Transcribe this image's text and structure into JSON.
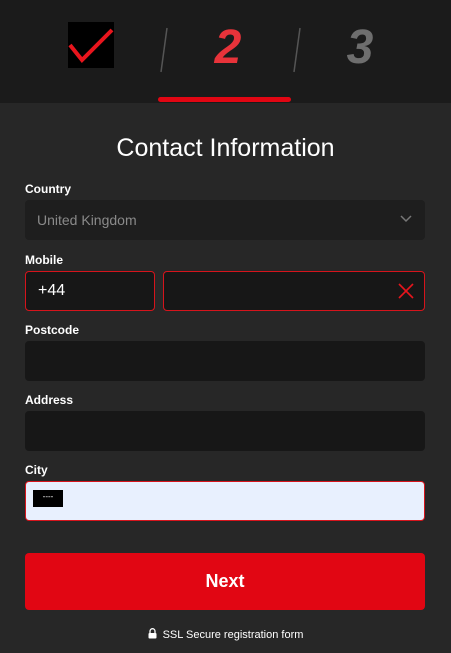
{
  "stepper": {
    "steps": [
      {
        "state": "completed",
        "icon": "checkmark-icon"
      },
      {
        "label": "2",
        "state": "active"
      },
      {
        "label": "3",
        "state": "upcoming"
      }
    ],
    "colors": {
      "active": "#e8333a",
      "inactive": "#6e6e6e",
      "accent": "#e10613"
    }
  },
  "form": {
    "title": "Contact Information",
    "country": {
      "label": "Country",
      "value": "United Kingdom"
    },
    "mobile": {
      "label": "Mobile",
      "prefix": "+44",
      "value": ""
    },
    "postcode": {
      "label": "Postcode",
      "value": ""
    },
    "address": {
      "label": "Address",
      "value": ""
    },
    "city": {
      "label": "City",
      "value": "",
      "autofill_chip": "----"
    },
    "next_label": "Next",
    "ssl_text": "SSL Secure registration form"
  }
}
